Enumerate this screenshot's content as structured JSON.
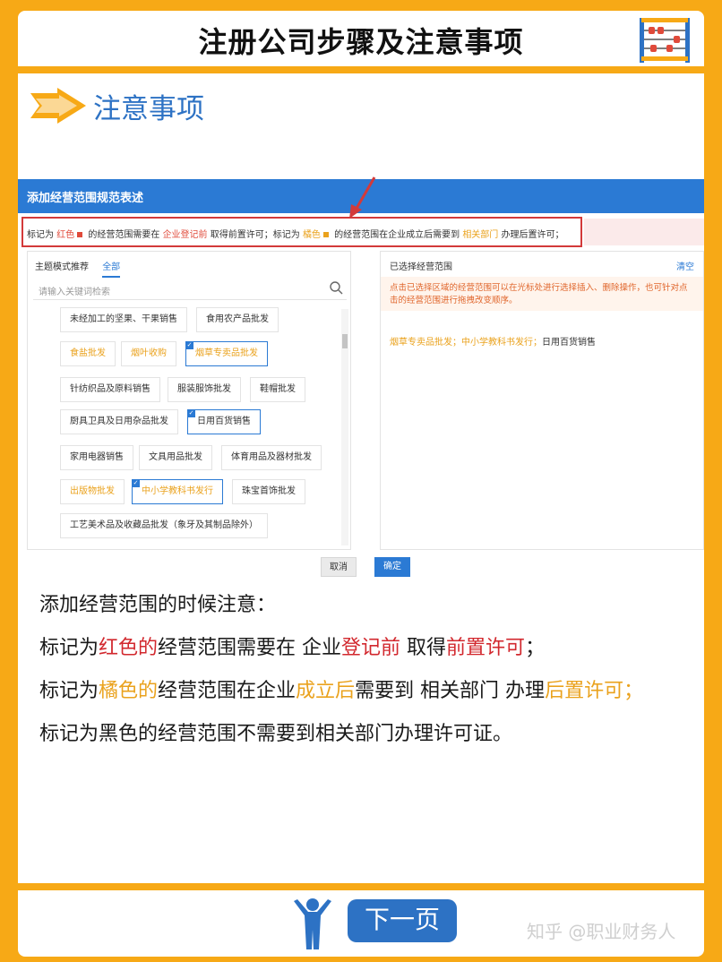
{
  "header": {
    "title": "注册公司步骤及注意事项"
  },
  "section": {
    "title": "注意事项"
  },
  "screenshot": {
    "bar_title": "添加经营范围规范表述",
    "legend": {
      "p1": "标记为",
      "red": "红色",
      "p2": "的经营范围需要在",
      "red_place": "企业登记前",
      "p3": "取得前置许可；标记为",
      "orange": "橘色",
      "p4": "的经营范围在企业成立后需要到",
      "orange_place": "相关部门",
      "p5": "办理后置许可；"
    },
    "tabs": {
      "recommend": "主题模式推荐",
      "all": "全部"
    },
    "search_placeholder": "请输入关键词检索",
    "tags": [
      "未经加工的坚果、干果销售",
      "食用农产品批发",
      "食盐批发",
      "烟叶收购",
      "烟草专卖品批发",
      "针纺织品及原料销售",
      "服装服饰批发",
      "鞋帽批发",
      "厨具卫具及日用杂品批发",
      "日用百货销售",
      "家用电器销售",
      "文具用品批发",
      "体育用品及器材批发",
      "出版物批发",
      "中小学教科书发行",
      "珠宝首饰批发",
      "工艺美术品及收藏品批发（象牙及其制品除外）"
    ],
    "selected_head": "已选择经营范围",
    "clear": "清空",
    "note": "点击已选择区域的经营范围可以在光标处进行选择插入、删除操作，也可针对点击的经营范围进行拖拽改变顺序。",
    "selected": {
      "s1": "烟草专卖品批发；",
      "s2": "中小学教科书发行；",
      "s3": "日用百货销售"
    },
    "cancel": "取消",
    "ok": "确定"
  },
  "body": {
    "l1": "添加经营范围的时候注意：",
    "l2": {
      "a": "标记为",
      "b": "红色的",
      "c": "经营范围需要在 企业",
      "d": "登记前",
      "e": " 取得",
      "f": "前置许可",
      "g": "；"
    },
    "l3": {
      "a": "标记为",
      "b": "橘色的",
      "c": "经营范围在企业",
      "d": "成立后",
      "e": "需要到 相关部门 办理",
      "f": "后置许可；"
    },
    "l4": "标记为黑色的经营范围不需要到相关部门办理许可证。"
  },
  "footer": {
    "next": "下一页",
    "watermark": "知乎 @职业财务人"
  },
  "colors": {
    "brand_orange": "#f7a916",
    "blue": "#2d72c4",
    "red": "#d2282e"
  }
}
